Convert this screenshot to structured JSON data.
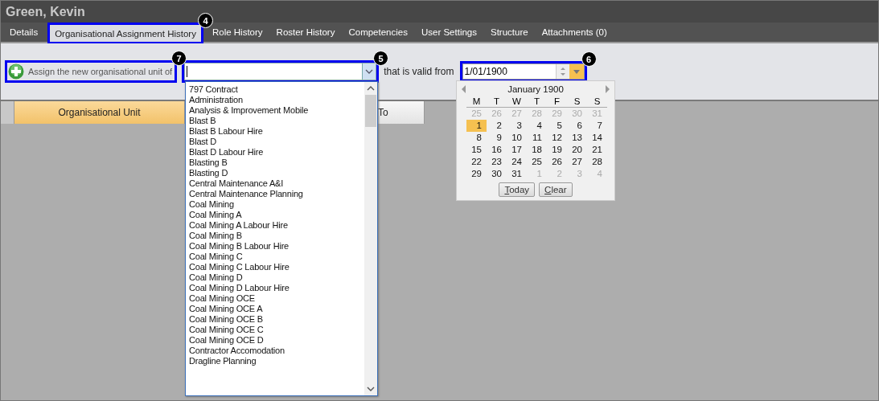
{
  "window": {
    "title": "Green, Kevin"
  },
  "tabs": [
    {
      "label": "Details",
      "selected": false
    },
    {
      "label": "Organisational Assignment History",
      "selected": true,
      "callout": "4"
    },
    {
      "label": "Role History",
      "selected": false
    },
    {
      "label": "Roster History",
      "selected": false
    },
    {
      "label": "Competencies",
      "selected": false
    },
    {
      "label": "User Settings",
      "selected": false
    },
    {
      "label": "Structure",
      "selected": false
    },
    {
      "label": "Attachments (0)",
      "selected": false
    }
  ],
  "toolbar": {
    "add_button": {
      "label": "Assign the new organisational unit of",
      "callout": "7"
    },
    "unit_combo": {
      "expanded": true,
      "callout": "5"
    },
    "valid_from_label": "that is valid from",
    "date_field": {
      "value": "1/01/1900",
      "expanded": true,
      "callout": "6"
    }
  },
  "grid": {
    "columns": [
      {
        "label": "Organisational Unit",
        "sorted": true
      },
      {
        "label": "To",
        "sorted": false
      }
    ]
  },
  "unit_options": [
    "797 Contract",
    "Administration",
    "Analysis & Improvement Mobile",
    "Blast B",
    "Blast B Labour Hire",
    "Blast D",
    "Blast D Labour Hire",
    "Blasting B",
    "Blasting D",
    "Central Maintenance A&I",
    "Central Maintenance Planning",
    "Coal Mining",
    "Coal Mining A",
    "Coal Mining A Labour Hire",
    "Coal Mining B",
    "Coal Mining B Labour Hire",
    "Coal Mining C",
    "Coal Mining C Labour Hire",
    "Coal Mining D",
    "Coal Mining D Labour Hire",
    "Coal Mining OCE",
    "Coal Mining OCE A",
    "Coal Mining OCE B",
    "Coal Mining OCE C",
    "Coal Mining OCE D",
    "Contractor Accomodation",
    "Dragline Planning"
  ],
  "calendar": {
    "month": "January 1900",
    "weekdays": [
      "M",
      "T",
      "W",
      "T",
      "F",
      "S",
      "S"
    ],
    "days": [
      {
        "day": "25",
        "other_month": true,
        "selected": false
      },
      {
        "day": "26",
        "other_month": true,
        "selected": false
      },
      {
        "day": "27",
        "other_month": true,
        "selected": false
      },
      {
        "day": "28",
        "other_month": true,
        "selected": false
      },
      {
        "day": "29",
        "other_month": true,
        "selected": false
      },
      {
        "day": "30",
        "other_month": true,
        "selected": false
      },
      {
        "day": "31",
        "other_month": true,
        "selected": false
      },
      {
        "day": "1",
        "other_month": false,
        "selected": true
      },
      {
        "day": "2",
        "other_month": false,
        "selected": false
      },
      {
        "day": "3",
        "other_month": false,
        "selected": false
      },
      {
        "day": "4",
        "other_month": false,
        "selected": false
      },
      {
        "day": "5",
        "other_month": false,
        "selected": false
      },
      {
        "day": "6",
        "other_month": false,
        "selected": false
      },
      {
        "day": "7",
        "other_month": false,
        "selected": false
      },
      {
        "day": "8",
        "other_month": false,
        "selected": false
      },
      {
        "day": "9",
        "other_month": false,
        "selected": false
      },
      {
        "day": "10",
        "other_month": false,
        "selected": false
      },
      {
        "day": "11",
        "other_month": false,
        "selected": false
      },
      {
        "day": "12",
        "other_month": false,
        "selected": false
      },
      {
        "day": "13",
        "other_month": false,
        "selected": false
      },
      {
        "day": "14",
        "other_month": false,
        "selected": false
      },
      {
        "day": "15",
        "other_month": false,
        "selected": false
      },
      {
        "day": "16",
        "other_month": false,
        "selected": false
      },
      {
        "day": "17",
        "other_month": false,
        "selected": false
      },
      {
        "day": "18",
        "other_month": false,
        "selected": false
      },
      {
        "day": "19",
        "other_month": false,
        "selected": false
      },
      {
        "day": "20",
        "other_month": false,
        "selected": false
      },
      {
        "day": "21",
        "other_month": false,
        "selected": false
      },
      {
        "day": "22",
        "other_month": false,
        "selected": false
      },
      {
        "day": "23",
        "other_month": false,
        "selected": false
      },
      {
        "day": "24",
        "other_month": false,
        "selected": false
      },
      {
        "day": "25",
        "other_month": false,
        "selected": false
      },
      {
        "day": "26",
        "other_month": false,
        "selected": false
      },
      {
        "day": "27",
        "other_month": false,
        "selected": false
      },
      {
        "day": "28",
        "other_month": false,
        "selected": false
      },
      {
        "day": "29",
        "other_month": false,
        "selected": false
      },
      {
        "day": "30",
        "other_month": false,
        "selected": false
      },
      {
        "day": "31",
        "other_month": false,
        "selected": false
      },
      {
        "day": "1",
        "other_month": true,
        "selected": false
      },
      {
        "day": "2",
        "other_month": true,
        "selected": false
      },
      {
        "day": "3",
        "other_month": true,
        "selected": false
      },
      {
        "day": "4",
        "other_month": true,
        "selected": false
      }
    ],
    "buttons": [
      {
        "label": "Today"
      },
      {
        "label": "Clear"
      }
    ]
  }
}
